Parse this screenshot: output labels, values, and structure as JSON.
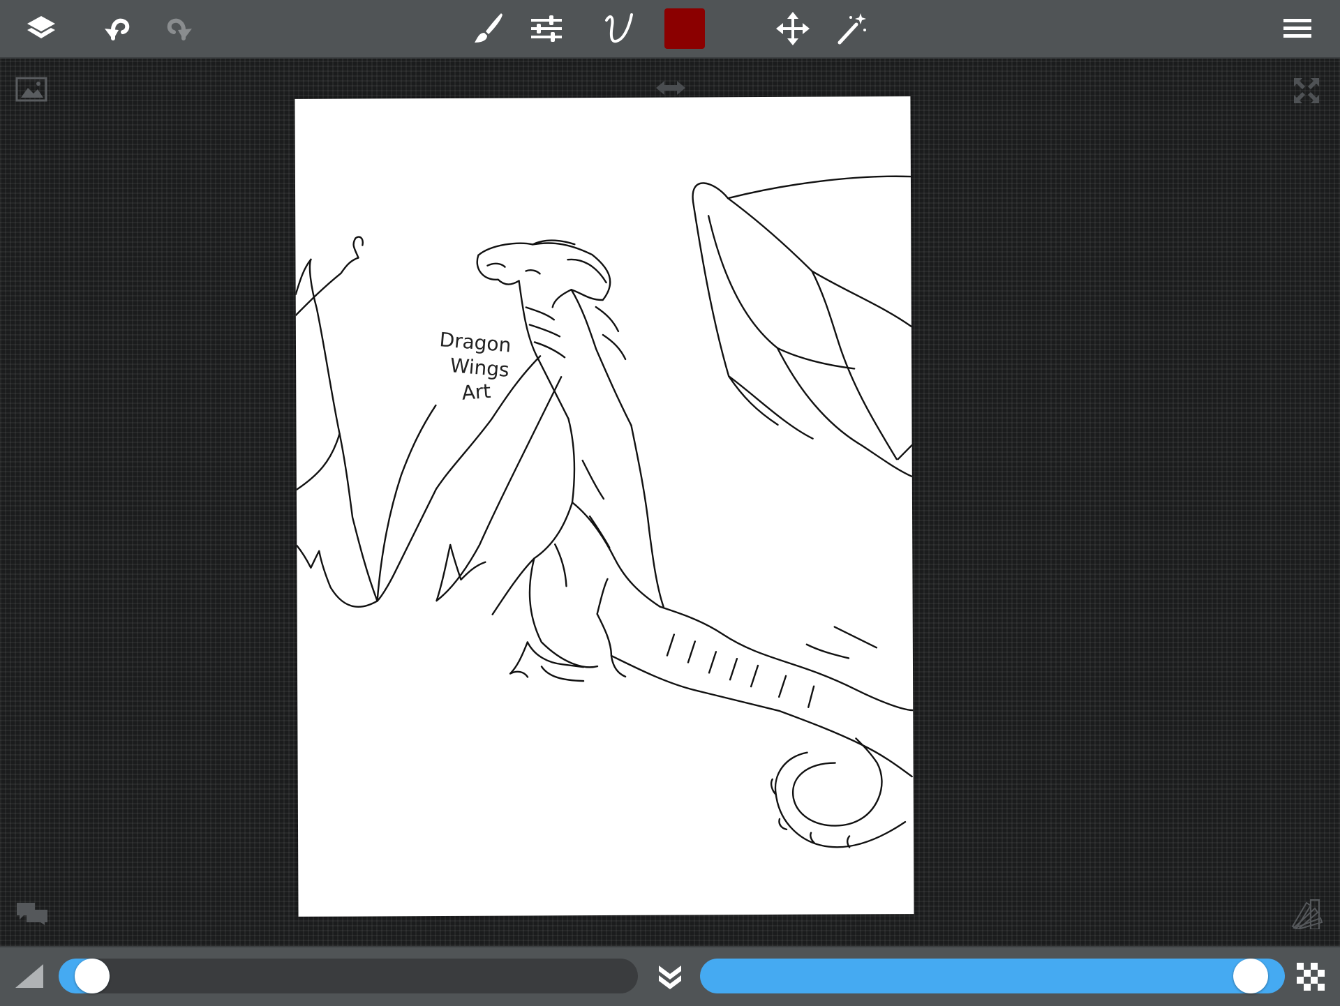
{
  "toolbar": {
    "left": [
      "layers-icon",
      "undo-icon",
      "redo-icon"
    ],
    "center": [
      "brush-icon",
      "sliders-icon",
      "stroke-curve-icon",
      "color-swatch",
      "move-icon",
      "magic-wand-icon"
    ],
    "right": [
      "menu-icon"
    ],
    "redo_enabled": false
  },
  "colors": {
    "current_color": "#8b0000",
    "toolbar_bg": "#505456",
    "workspace_bg": "#1b1c1d",
    "slider_accent": "#45aaf2",
    "slider_track": "#3a3c3e"
  },
  "canvas": {
    "artwork_text": [
      "Dragon",
      "Wings",
      "Art"
    ],
    "subject": "dragon line drawing"
  },
  "workspace_icons": [
    "reference-image-icon",
    "flip-horizontal-icon",
    "fullscreen-icon",
    "chat-icon",
    "color-palette-icon"
  ],
  "bottom_bar": {
    "brush_size_value": 0.03,
    "opacity_value": 0.97,
    "icons": [
      "size-triangle-icon",
      "collapse-down-icon",
      "transparency-checker-icon"
    ]
  }
}
